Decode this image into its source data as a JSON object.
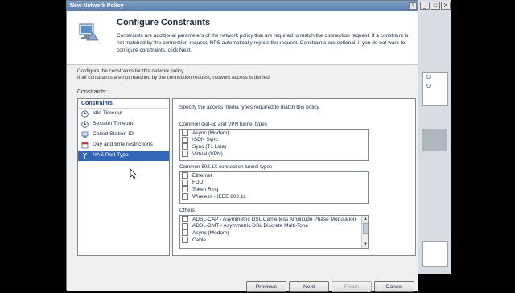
{
  "background": {
    "right_list_items": [
      "U",
      "U"
    ]
  },
  "dialog": {
    "title": "New Network Policy",
    "header": {
      "title": "Configure Constraints",
      "description": "Constraints are additional parameters of the network policy that are required to match the connection request. If a constraint is not matched by the connection request, NPS automatically rejects the request. Constraints are optional; if you do not want to configure constraints, click Next."
    },
    "intro_line1": "Configure the constraints for this network policy.",
    "intro_line2": "If all constraints are not matched by the connection request, network access is denied.",
    "constraints_label": "Constraints:",
    "left_pane": {
      "header": "Constraints",
      "items": [
        {
          "label": "Idle Timeout",
          "icon": "clock-icon"
        },
        {
          "label": "Session Timeout",
          "icon": "clock-icon"
        },
        {
          "label": "Called Station ID",
          "icon": "station-icon"
        },
        {
          "label": "Day and time restrictions",
          "icon": "calendar-icon"
        },
        {
          "label": "NAS Port Type",
          "icon": "port-icon",
          "selected": true
        }
      ]
    },
    "right_pane": {
      "intro": "Specify the access media types required to match this policy",
      "groups": [
        {
          "label": "Common dial-up and VPN tunnel types",
          "items": [
            "Async (Modem)",
            "ISDN Sync",
            "Sync (T1 Line)",
            "Virtual (VPN)"
          ]
        },
        {
          "label": "Common 802.1X connection tunnel types",
          "items": [
            "Ethernet",
            "FDDI",
            "Token Ring",
            "Wireless - IEEE 802.11"
          ]
        },
        {
          "label": "Others",
          "items": [
            "ADSL-CAP - Asymmetric DSL Carrierless Amplitude Phase Modulation",
            "ADSL-DMT - Asymmetric DSL Discrete Multi-Tone",
            "Async (Modem)",
            "Cable"
          ]
        }
      ]
    },
    "buttons": {
      "previous": "Previous",
      "next": "Next",
      "finish": "Finish",
      "cancel": "Cancel"
    },
    "window_controls": {
      "help": "?",
      "close": "X"
    },
    "outer_controls": {
      "minimize": "_",
      "maximize": "□",
      "close": "X"
    }
  },
  "colors": {
    "selection": "#3165b6",
    "title_gradient_top": "#7f9fc5"
  }
}
